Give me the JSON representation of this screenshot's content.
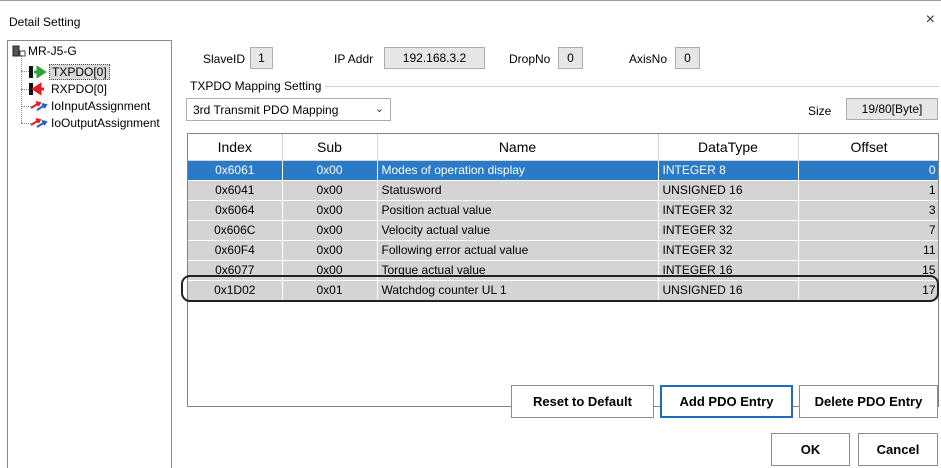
{
  "window": {
    "title": "Detail Setting",
    "close_glyph": "×"
  },
  "tree": {
    "root": {
      "label": "MR-J5-G",
      "icon": "device-icon"
    },
    "items": [
      {
        "label": "TXPDO[0]",
        "icon": "tx-arrow-icon"
      },
      {
        "label": "RXPDO[0]",
        "icon": "rx-arrow-icon"
      },
      {
        "label": "IoInputAssignment",
        "icon": "io-assign-icon"
      },
      {
        "label": "IoOutputAssignment",
        "icon": "io-assign-icon"
      }
    ]
  },
  "header": {
    "slave_id_label": "SlaveID",
    "slave_id_value": "1",
    "ip_label": "IP Addr",
    "ip_value": "192.168.3.2",
    "drop_label": "DropNo",
    "drop_value": "0",
    "axis_label": "AxisNo",
    "axis_value": "0"
  },
  "mapping": {
    "group_label": "TXPDO Mapping Setting",
    "combo_value": "3rd Transmit PDO Mapping",
    "size_label": "Size",
    "size_value": "19/80[Byte]"
  },
  "grid": {
    "columns": [
      "Index",
      "Sub",
      "Name",
      "DataType",
      "Offset"
    ],
    "rows": [
      {
        "index": "0x6061",
        "sub": "0x00",
        "name": "Modes of operation display",
        "datatype": "INTEGER 8",
        "offset": "0"
      },
      {
        "index": "0x6041",
        "sub": "0x00",
        "name": "Statusword",
        "datatype": "UNSIGNED 16",
        "offset": "1"
      },
      {
        "index": "0x6064",
        "sub": "0x00",
        "name": "Position actual value",
        "datatype": "INTEGER 32",
        "offset": "3"
      },
      {
        "index": "0x606C",
        "sub": "0x00",
        "name": "Velocity actual value",
        "datatype": "INTEGER 32",
        "offset": "7"
      },
      {
        "index": "0x60F4",
        "sub": "0x00",
        "name": "Following error actual value",
        "datatype": "INTEGER 32",
        "offset": "11"
      },
      {
        "index": "0x6077",
        "sub": "0x00",
        "name": "Torque actual value",
        "datatype": "INTEGER 16",
        "offset": "15"
      },
      {
        "index": "0x1D02",
        "sub": "0x01",
        "name": "Watchdog counter UL 1",
        "datatype": "UNSIGNED 16",
        "offset": "17"
      }
    ],
    "selected_row": 0
  },
  "buttons": {
    "reset": "Reset to Default",
    "add": "Add PDO Entry",
    "delete": "Delete PDO Entry",
    "ok": "OK",
    "cancel": "Cancel"
  },
  "colors": {
    "selection": "#2a7ac7",
    "row_bg": "#d4d4d4",
    "primary_border": "#1e6bc0"
  }
}
